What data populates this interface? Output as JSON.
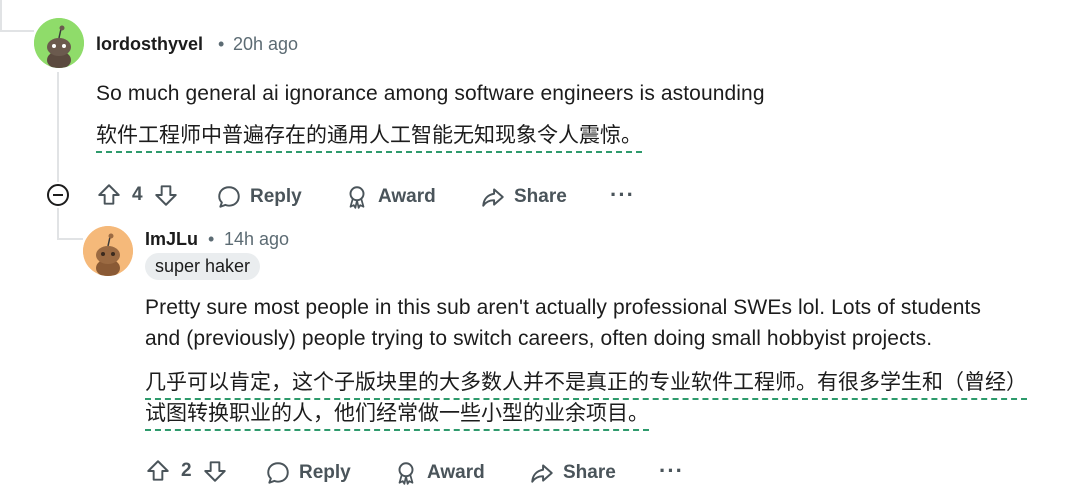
{
  "comment1": {
    "username": "lordosthyvel",
    "separator": "•",
    "time": "20h ago",
    "body_en": "So much general ai ignorance among software engineers is astounding",
    "body_zh": "软件工程师中普遍存在的通用人工智能无知现象令人震惊。",
    "votes": "4",
    "reply_label": "Reply",
    "award_label": "Award",
    "share_label": "Share",
    "more_label": "···",
    "avatar_color": "#8fdc6a"
  },
  "comment2": {
    "username": "ImJLu",
    "separator": "•",
    "time": "14h ago",
    "flair": "super haker",
    "body_en_line1": "Pretty sure most people in this sub aren't actually professional SWEs lol. Lots of students",
    "body_en_line2": "and (previously) people trying to switch careers, often doing small hobbyist projects.",
    "body_zh_line1": "几乎可以肯定，这个子版块里的大多数人并不是真正的专业软件工程师。有很多学生和（曾经）",
    "body_zh_line2": "试图转换职业的人，他们经常做一些小型的业余项目。",
    "votes": "2",
    "reply_label": "Reply",
    "award_label": "Award",
    "share_label": "Share",
    "more_label": "···",
    "avatar_color": "#f5b97a"
  },
  "colors": {
    "thread_line": "#e1e3e5",
    "translation_underline": "#2e9a6c",
    "action_text": "#4a545a",
    "meta_text": "#5c6b73"
  }
}
